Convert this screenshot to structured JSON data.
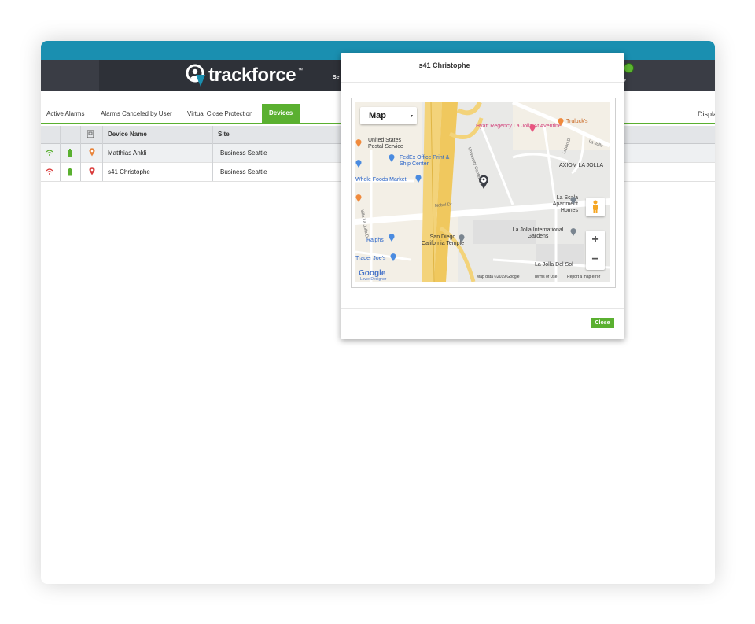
{
  "header": {
    "logo_text": "trackforce",
    "logo_tm": "™",
    "nav_fragment": "Se",
    "user_caret": "▾"
  },
  "tabs": [
    {
      "label": "Active Alarms",
      "active": false
    },
    {
      "label": "Alarms Canceled by User",
      "active": false
    },
    {
      "label": "Virtual Close Protection",
      "active": false
    },
    {
      "label": "Devices",
      "active": true
    }
  ],
  "display_fragment": "Displa",
  "table": {
    "columns": [
      "",
      "",
      "",
      "Device Name",
      "Site"
    ],
    "rows": [
      {
        "signal": "wifi-icon",
        "signal_color": "#5ab030",
        "battery_color": "#5ab030",
        "pin_color": "#e8833a",
        "device_name": "Matthias Ankli",
        "site": "Business Seattle"
      },
      {
        "signal": "wifi-off-icon",
        "signal_color": "#d93a3a",
        "battery_color": "#5ab030",
        "pin_color": "#d93a3a",
        "device_name": "s41 Christophe",
        "site": "Business Seattle"
      }
    ]
  },
  "modal": {
    "title": "s41 Christophe",
    "close_label": "Close",
    "map": {
      "type_label": "Map",
      "type_caret": "▾",
      "zoom_in": "+",
      "zoom_out": "−",
      "places": {
        "hyatt": "Hyatt Regency La Jolla At Aventine",
        "trulucks": "Truluck's",
        "usps": "United States Postal Service",
        "fedex": "FedEx Office Print & Ship Center",
        "axiom": "AXIOM LA JOLLA",
        "wholefoods": "Whole Foods Market",
        "lascala": "La Scala Apartment Homes",
        "ljgardens": "La Jolla International Gardens",
        "ralphs": "Ralphs",
        "temple": "San Diego California Temple",
        "traderjoes": "Trader Joe's",
        "ljdelsol": "La Jolla Del Sol"
      },
      "streets": {
        "nobel": "Nobel Dr",
        "lajolla": "La Jolla",
        "ucl": "University Center Ln",
        "lebon": "Lebon Dr",
        "vvilla": "Villa La Jolla Dr"
      },
      "attribution": {
        "brand": "Google",
        "map_data": "Map data ©2019 Google",
        "terms": "Terms of Use",
        "report": "Report a map error",
        "cut_label": "Lowe Designer"
      }
    }
  }
}
